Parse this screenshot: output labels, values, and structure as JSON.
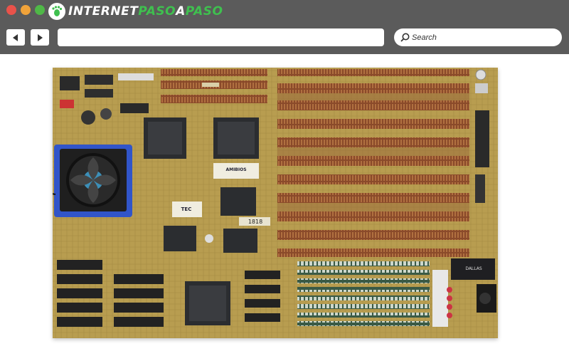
{
  "window": {
    "controls": [
      "close",
      "minimize",
      "maximize"
    ]
  },
  "logo": {
    "part1": "INTERNET",
    "part2": "PASO",
    "part3": "A",
    "part4": "PASO"
  },
  "toolbar": {
    "back_icon": "arrow-left-icon",
    "forward_icon": "arrow-right-icon",
    "url_value": "",
    "search_label": "Search"
  },
  "content": {
    "image_subject": "motherboard",
    "chip_labels": {
      "eprom": "AMIBIOS",
      "clock": "TEC",
      "part_number": "1818",
      "rtc": "DALLAS"
    }
  },
  "colors": {
    "chrome": "#5b5b5b",
    "logo_accent": "#3fc04f",
    "board": "#b89d50",
    "slot": "#8a4a2a"
  }
}
